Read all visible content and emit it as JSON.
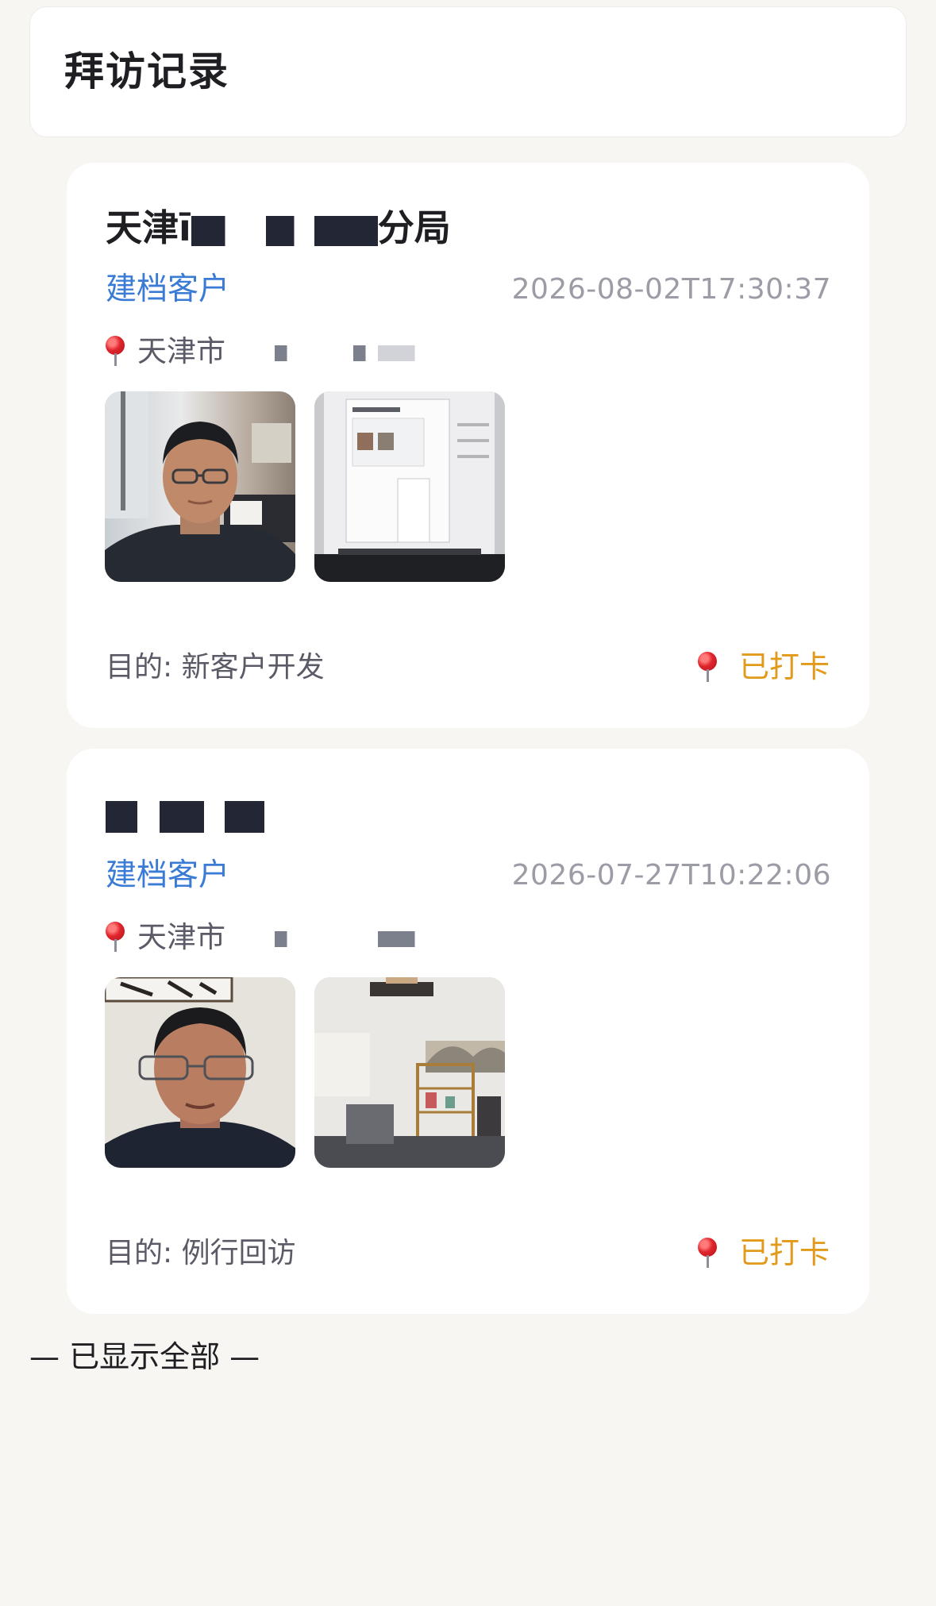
{
  "header": {
    "title": "拜访记录"
  },
  "visits": [
    {
      "title_prefix": "天津ī",
      "title_suffix": "分局",
      "tag": "建档客户",
      "time": "2026-08-02T17:30:37",
      "address_prefix": "天津市",
      "photos": [
        "selfie-photo",
        "computer-screen-photo"
      ],
      "purpose": "目的: 新客户开发",
      "checkin_label": "已打卡"
    },
    {
      "tag": "建档客户",
      "time": "2026-07-27T10:22:06",
      "address_prefix": "天津市",
      "photos": [
        "selfie-photo",
        "office-room-photo"
      ],
      "purpose": "目的: 例行回访",
      "checkin_label": "已打卡"
    }
  ],
  "footer": {
    "end_text": "— 已显示全部 —"
  },
  "colors": {
    "page_background": "#f7f6f3",
    "tag_blue": "#3a7bd5",
    "checkin_orange": "#e29a1b",
    "timestamp_gray": "#9b9ca5"
  },
  "icons": {
    "location": "location-pin-icon"
  }
}
